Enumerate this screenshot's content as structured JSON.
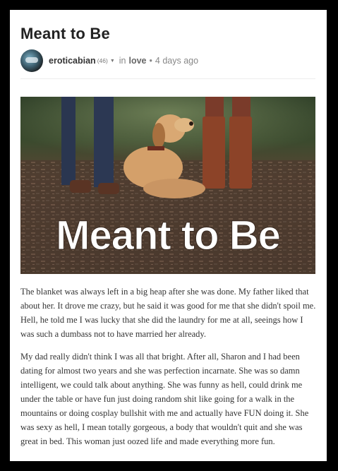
{
  "post": {
    "title": "Meant to Be",
    "author": "eroticabian",
    "reputation": "(46)",
    "in_label": "in",
    "category": "love",
    "separator": "•",
    "timestamp": "4 days ago"
  },
  "hero": {
    "overlay_text": "Meant to Be",
    "icon": "dog-between-legs-photo"
  },
  "paragraphs": [
    "The blanket was always left in a big heap after she was done. My father liked that about her. It drove me crazy, but he said it was good for me that she didn't spoil me. Hell, he told me I was lucky that she did the laundry for me at all, seeings how I was such a dumbass not to have married her already.",
    "My dad really didn't think I was all that bright. After all, Sharon and I had been dating for almost two years and she was perfection incarnate. She was so damn intelligent, we could talk about anything. She was funny as hell, could drink me under the table or have fun just doing random shit like going for a walk in the mountains or doing cosplay bullshit with me and actually have FUN doing it. She was sexy as hell, I mean totally gorgeous, a body that wouldn't quit and she was great in bed. This woman just oozed life and made everything more fun."
  ],
  "colors": {
    "background": "#000000",
    "page": "#ffffff",
    "text": "#333333",
    "muted": "#888888"
  }
}
